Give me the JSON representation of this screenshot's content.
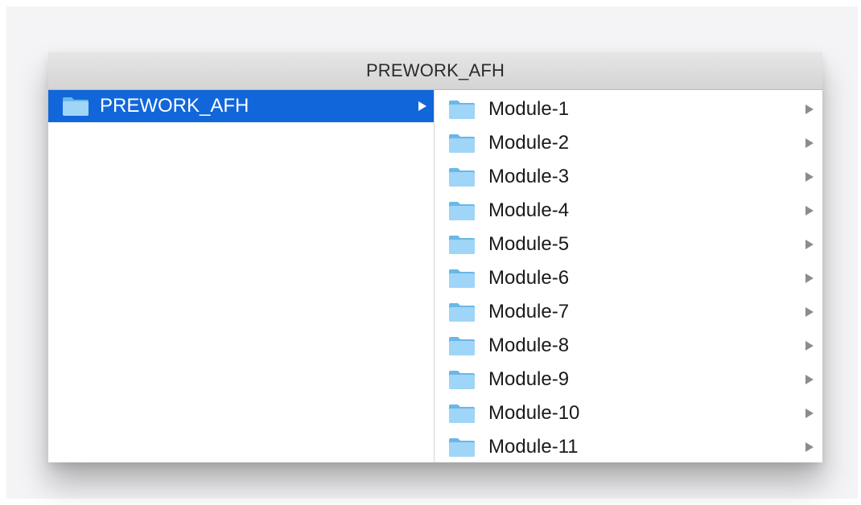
{
  "window": {
    "title": "PREWORK_AFH"
  },
  "sidebar": {
    "items": [
      {
        "label": "PREWORK_AFH",
        "icon": "folder-icon",
        "selected": true
      }
    ]
  },
  "contents": {
    "items": [
      {
        "label": "Module-1",
        "icon": "folder-icon"
      },
      {
        "label": "Module-2",
        "icon": "folder-icon"
      },
      {
        "label": "Module-3",
        "icon": "folder-icon"
      },
      {
        "label": "Module-4",
        "icon": "folder-icon"
      },
      {
        "label": "Module-5",
        "icon": "folder-icon"
      },
      {
        "label": "Module-6",
        "icon": "folder-icon"
      },
      {
        "label": "Module-7",
        "icon": "folder-icon"
      },
      {
        "label": "Module-8",
        "icon": "folder-icon"
      },
      {
        "label": "Module-9",
        "icon": "folder-icon"
      },
      {
        "label": "Module-10",
        "icon": "folder-icon"
      },
      {
        "label": "Module-11",
        "icon": "folder-icon"
      }
    ]
  },
  "colors": {
    "selection": "#1166d9",
    "folder_fill": "#7cc4f0",
    "folder_tab": "#6ab7e8",
    "folder_front": "#9fd5f7",
    "chevron": "#8c8c8c"
  }
}
